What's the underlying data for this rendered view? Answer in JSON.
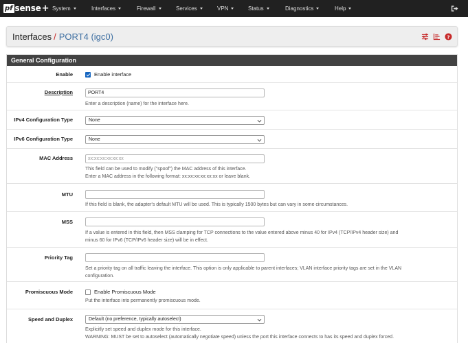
{
  "navbar": {
    "logo": {
      "pf": "pf",
      "sense": "sense",
      "plus": "+"
    },
    "menu": [
      {
        "label": "System"
      },
      {
        "label": "Interfaces"
      },
      {
        "label": "Firewall"
      },
      {
        "label": "Services"
      },
      {
        "label": "VPN"
      },
      {
        "label": "Status"
      },
      {
        "label": "Diagnostics"
      },
      {
        "label": "Help"
      }
    ],
    "logout_icon": "sign-out-icon"
  },
  "title": {
    "section": "Interfaces",
    "separator": "/",
    "current": "PORT4 (igc0)",
    "icons": [
      "sliders-icon",
      "list-chart-icon",
      "help-icon"
    ]
  },
  "panel": {
    "heading": "General Configuration",
    "enable": {
      "label": "Enable",
      "checkbox_label": "Enable interface",
      "checked": true
    },
    "description": {
      "label": "Description",
      "value": "PORT4",
      "help": "Enter a description (name) for the interface here."
    },
    "ipv4": {
      "label": "IPv4 Configuration Type",
      "value": "None"
    },
    "ipv6": {
      "label": "IPv6 Configuration Type",
      "value": "None"
    },
    "mac": {
      "label": "MAC Address",
      "placeholder": "xx:xx:xx:xx:xx:xx",
      "help1": "This field can be used to modify (\"spoof\") the MAC address of this interface.",
      "help2": "Enter a MAC address in the following format: xx:xx:xx:xx:xx:xx or leave blank."
    },
    "mtu": {
      "label": "MTU",
      "value": "",
      "help": "If this field is blank, the adapter's default MTU will be used. This is typically 1500 bytes but can vary in some circumstances."
    },
    "mss": {
      "label": "MSS",
      "value": "",
      "help1": "If a value is entered in this field, then MSS clamping for TCP connections to the value entered above minus 40 for IPv4 (TCP/IPv4 header size) and",
      "help2": "minus 60 for IPv6 (TCP/IPv6 header size) will be in effect."
    },
    "priority": {
      "label": "Priority Tag",
      "value": "",
      "help1": "Set a priority tag on all traffic leaving the interface. This option is only applicable to parent interfaces; VLAN interface priority tags are set in the VLAN",
      "help2": "configuration."
    },
    "promisc": {
      "label": "Promiscuous Mode",
      "checkbox_label": "Enable Promiscuous Mode",
      "checked": false,
      "help": "Put the interface into permanently promiscuous mode."
    },
    "speed": {
      "label": "Speed and Duplex",
      "value": "Default (no preference, typically autoselect)",
      "help1": "Explicitly set speed and duplex mode for this interface.",
      "help2": "WARNING: MUST be set to autoselect (automatically negotiate speed) unless the port this interface connects to has its speed and duplex forced."
    }
  },
  "colors": {
    "navbar": "#212121",
    "panel_heading": "#424242",
    "breadcrumb_current": "#3d6ea1",
    "accent_red": "#c62828",
    "checkbox_on": "#1565c0"
  }
}
